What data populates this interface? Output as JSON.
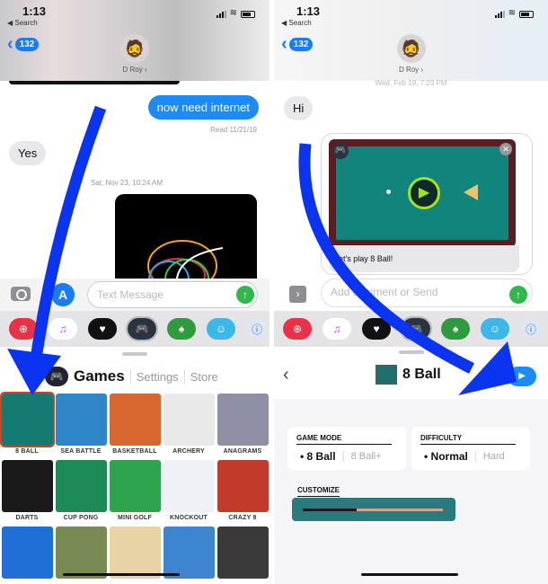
{
  "left": {
    "status": {
      "time": "1:13",
      "back_app": "◀ Search"
    },
    "nav": {
      "unread_count": "132",
      "contact_name": "D Roy ›"
    },
    "messages": [
      {
        "from": "me",
        "text": "now need internet"
      },
      {
        "from": "meta",
        "text": "Read 11/21/19"
      },
      {
        "from": "them",
        "text": "Yes"
      },
      {
        "from": "meta",
        "text": "Sat, Nov 23, 10:24 AM"
      }
    ],
    "input": {
      "placeholder": "Text Message"
    },
    "games_sheet": {
      "title": "Games",
      "links": [
        "Settings",
        "Store"
      ],
      "games": [
        {
          "label": "8 BALL",
          "color": "#147a72"
        },
        {
          "label": "SEA BATTLE",
          "color": "#2f86c9"
        },
        {
          "label": "BASKETBALL",
          "color": "#d8672f"
        },
        {
          "label": "ARCHERY",
          "color": "#e9e9e9"
        },
        {
          "label": "ANAGRAMS",
          "color": "#8f8fa6"
        },
        {
          "label": "DARTS",
          "color": "#1a1a1a"
        },
        {
          "label": "CUP PONG",
          "color": "#1d8a57"
        },
        {
          "label": "MINI GOLF",
          "color": "#2ea44f"
        },
        {
          "label": "KNOCKOUT",
          "color": "#eef1f5"
        },
        {
          "label": "CRAZY 8",
          "color": "#c23a2a"
        },
        {
          "label": "",
          "color": "#1f6fd6"
        },
        {
          "label": "",
          "color": "#7a8a55"
        },
        {
          "label": "",
          "color": "#e8d3a6"
        },
        {
          "label": "",
          "color": "#3d86cf"
        },
        {
          "label": "",
          "color": "#3a3a3a"
        }
      ]
    }
  },
  "right": {
    "status": {
      "time": "1:13",
      "back_app": "◀ Search"
    },
    "nav": {
      "unread_count": "132",
      "contact_name": "D Roy ›"
    },
    "timestamp": "Wed, Feb 19, 7:23 PM",
    "messages": [
      {
        "from": "them",
        "text": "Hi"
      }
    ],
    "game_card": {
      "caption": "Let's play 8 Ball!"
    },
    "input": {
      "placeholder": "Add comment or Send"
    },
    "game_sheet": {
      "title": "8 Ball",
      "game_mode": {
        "label": "GAME MODE",
        "selected": "• 8 Ball",
        "other": "8 Ball+"
      },
      "difficulty": {
        "label": "DIFFICULTY",
        "selected": "• Normal",
        "other": "Hard"
      },
      "customize_label": "CUSTOMIZE"
    }
  },
  "tray_apps": [
    {
      "name": "photo-search",
      "color": "#e8324a",
      "glyph": "⊕"
    },
    {
      "name": "music",
      "color": "#ffffff",
      "glyph": "♫"
    },
    {
      "name": "digital-touch",
      "color": "#111111",
      "glyph": "♥"
    },
    {
      "name": "gamepigeon",
      "color": "#2a3340",
      "glyph": "🎮"
    },
    {
      "name": "solitaire",
      "color": "#2f9a3e",
      "glyph": "♠"
    },
    {
      "name": "memoji",
      "color": "#3cb8e8",
      "glyph": "☺"
    },
    {
      "name": "1password",
      "color": "#e0e6f0",
      "glyph": "ⓘ"
    }
  ],
  "colors": {
    "ios_blue": "#1e8bf5",
    "send_green": "#2fb84c",
    "annotation_arrow": "#0a34f0"
  }
}
